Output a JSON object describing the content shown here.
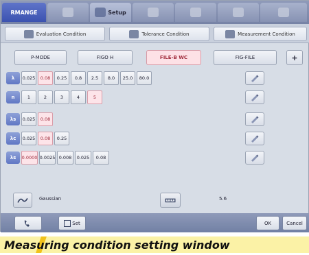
{
  "top_tabs": [
    {
      "label": "RMANGE",
      "icon": "measure-icon"
    },
    {
      "label": "",
      "icon": "probe-icon"
    },
    {
      "label": "Setup",
      "icon": "setup-icon"
    },
    {
      "label": "",
      "icon": "pen-icon"
    },
    {
      "label": "",
      "icon": "graph-icon"
    },
    {
      "label": "",
      "icon": "report-icon"
    },
    {
      "label": "",
      "icon": "tools-icon"
    }
  ],
  "sub_tabs": [
    {
      "label": "Evaluation Condition",
      "icon": "condition-icon"
    },
    {
      "label": "Tolerance Condition",
      "icon": "tolerance-icon"
    },
    {
      "label": "Measurement Condition",
      "icon": "measurement-icon"
    }
  ],
  "methods": {
    "labels": [
      "P-MODE",
      "FIGO H",
      "FILE-B WC",
      "FIG-FILE"
    ],
    "selected_index": 2,
    "add_label": "+"
  },
  "rows": [
    {
      "label": "λ",
      "cells": [
        "0.025",
        "0.08",
        "0.25",
        "0.8",
        "2.5",
        "8.0",
        "25.0",
        "80.0"
      ],
      "selected": [
        1
      ]
    },
    {
      "label": "n",
      "cells": [
        "1",
        "2",
        "3",
        "4",
        "5"
      ],
      "selected": [
        4
      ]
    },
    {
      "label": "λs",
      "cells": [
        "0.025",
        "0.08"
      ],
      "selected": [
        1
      ]
    },
    {
      "label": "λc",
      "cells": [
        "0.025",
        "0.08",
        "0.25"
      ],
      "selected": [
        1
      ]
    },
    {
      "label": "λs",
      "cells": [
        "0.0000",
        "0.0025",
        "0.008",
        "0.025",
        "0.08"
      ],
      "selected": [
        0
      ]
    }
  ],
  "filter": {
    "label": "Gaussian",
    "icon": "filter-icon"
  },
  "length": {
    "icon": "length-icon",
    "value": "5.6"
  },
  "footer": {
    "phone_icon": "phone-icon",
    "file_label": "Set",
    "ok_label": "OK",
    "cancel_label": "Cancel"
  },
  "caption": "Measuring condition setting window"
}
